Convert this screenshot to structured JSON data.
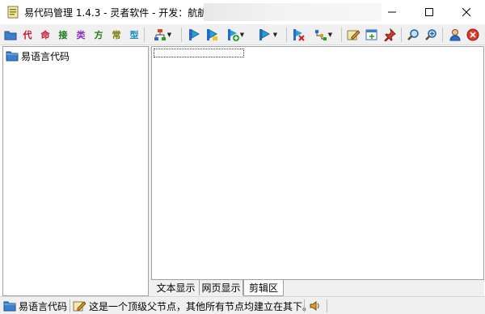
{
  "window": {
    "title": "易代码管理 1.4.3 - 灵者软件 - 开发：航航 -"
  },
  "toolbar": {
    "chars": [
      {
        "label": "代",
        "color": "#c8102e"
      },
      {
        "label": "命",
        "color": "#c8102e"
      },
      {
        "label": "接",
        "color": "#1f7a1f"
      },
      {
        "label": "类",
        "color": "#8e2ec2"
      },
      {
        "label": "方",
        "color": "#1f7a1f"
      },
      {
        "label": "常",
        "color": "#7a7a00"
      },
      {
        "label": "型",
        "color": "#1a8ab8"
      }
    ]
  },
  "tree": {
    "root_label": "易语言代码"
  },
  "tabs": [
    {
      "label": "文本显示"
    },
    {
      "label": "网页显示"
    },
    {
      "label": "剪辑区"
    }
  ],
  "status": {
    "node_label": "易语言代码",
    "message": "这是一个顶级父节点，其他所有节点均建立在其下。"
  }
}
